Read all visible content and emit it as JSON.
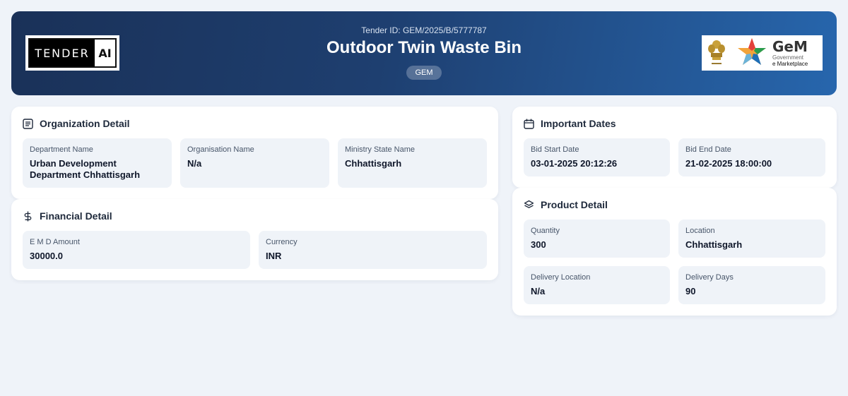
{
  "header": {
    "logo_left": {
      "word1": "TENDER",
      "word2": "AI"
    },
    "tender_id": "Tender ID: GEM/2025/B/5777787",
    "title": "Outdoor Twin Waste Bin",
    "badge": "GEM",
    "logo_right": {
      "title": "GeM",
      "sub1": "Government",
      "sub2": "e Marketplace"
    }
  },
  "organization": {
    "title": "Organization Detail",
    "icon": "document-list-icon",
    "fields": [
      {
        "label": "Department Name",
        "value": "Urban Development Department Chhattisgarh"
      },
      {
        "label": "Organisation Name",
        "value": "N/a"
      },
      {
        "label": "Ministry State Name",
        "value": "Chhattisgarh"
      }
    ]
  },
  "financial": {
    "title": "Financial Detail",
    "icon": "dollar-icon",
    "fields": [
      {
        "label": "E M D Amount",
        "value": "30000.0"
      },
      {
        "label": "Currency",
        "value": "INR"
      }
    ]
  },
  "dates": {
    "title": "Important Dates",
    "icon": "calendar-icon",
    "fields": [
      {
        "label": "Bid Start Date",
        "value": "03-01-2025 20:12:26"
      },
      {
        "label": "Bid End Date",
        "value": "21-02-2025 18:00:00"
      }
    ]
  },
  "product": {
    "title": "Product Detail",
    "icon": "layers-icon",
    "fields": [
      {
        "label": "Quantity",
        "value": "300"
      },
      {
        "label": "Location",
        "value": "Chhattisgarh"
      },
      {
        "label": "Delivery Location",
        "value": "N/a"
      },
      {
        "label": "Delivery Days",
        "value": "90"
      }
    ]
  }
}
